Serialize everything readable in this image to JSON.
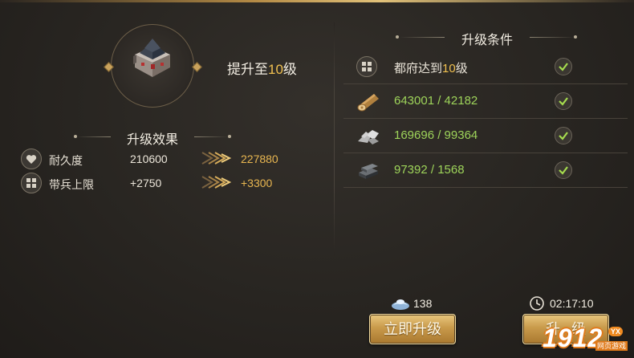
{
  "header": {
    "upgrade_prefix": "提升至",
    "upgrade_level": "10",
    "upgrade_suffix": "级"
  },
  "effects": {
    "title": "升级效果",
    "rows": [
      {
        "icon": "heart-icon",
        "label": "耐久度",
        "current": "210600",
        "next": "227880"
      },
      {
        "icon": "grid-icon",
        "label": "带兵上限",
        "current": "+2750",
        "next": "+3300"
      }
    ]
  },
  "requirements": {
    "title": "升级条件",
    "building_prefix": "都府达到",
    "building_level": "10",
    "building_suffix": "级",
    "resources": [
      {
        "icon": "wood-log-icon",
        "value": "643001 / 42182"
      },
      {
        "icon": "stone-icon",
        "value": "169696 / 99364"
      },
      {
        "icon": "iron-ingot-icon",
        "value": "97392 / 1568"
      }
    ]
  },
  "instant": {
    "cost": "138",
    "label": "立即升级"
  },
  "normal": {
    "time": "02:17:10",
    "label": "升级"
  },
  "watermark": {
    "number": "1912",
    "tag": "YX",
    "site": "网页游戏"
  },
  "colors": {
    "accent_gold": "#f0c050",
    "met_green": "#9ed45a",
    "button_gold": "#c99a4b"
  }
}
